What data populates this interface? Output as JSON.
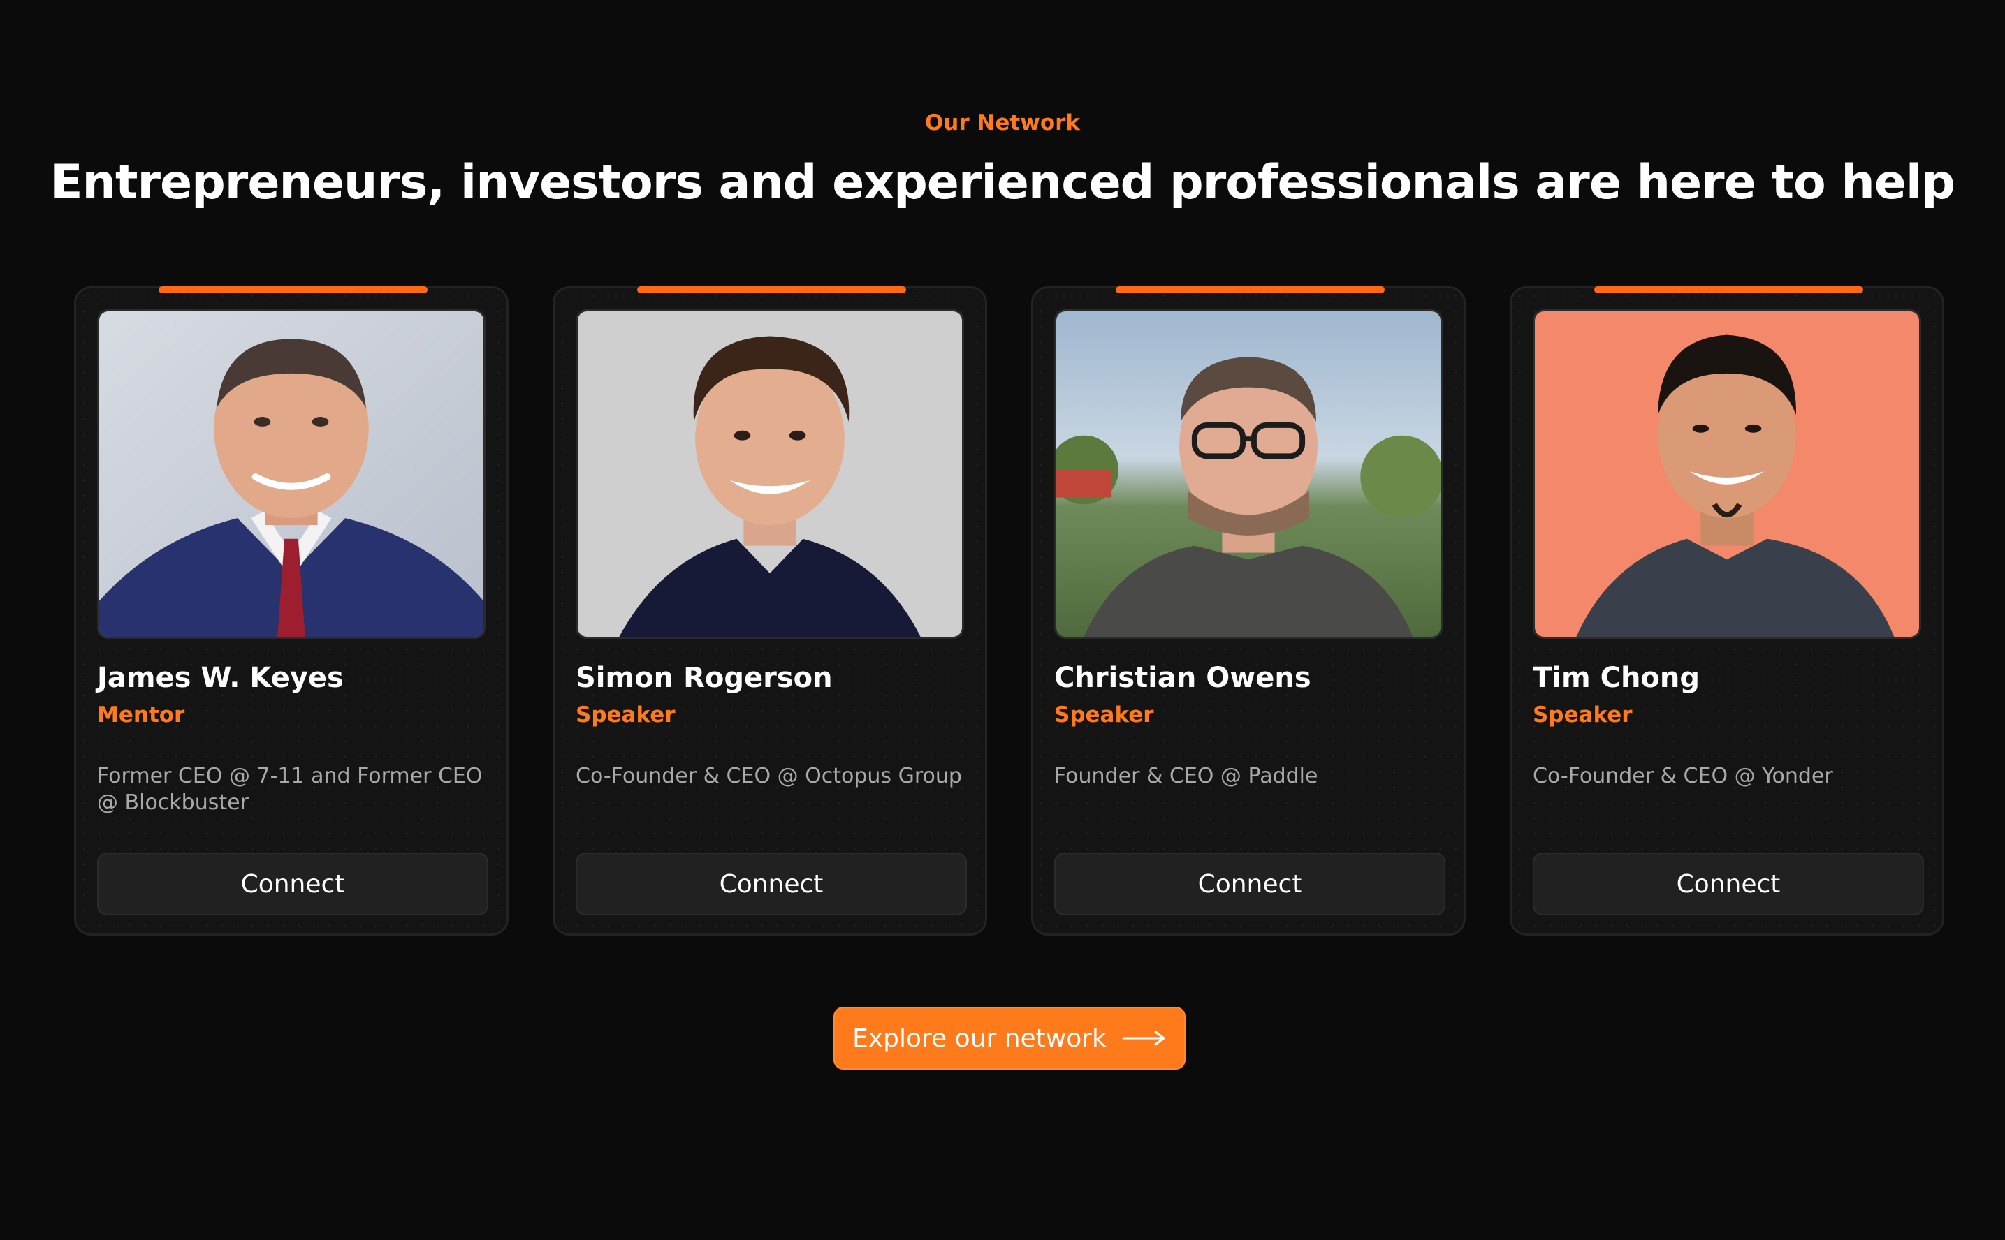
{
  "section": {
    "eyebrow": "Our Network",
    "headline": "Entrepreneurs, investors and experienced professionals are here to help"
  },
  "colors": {
    "accent": "#ff7a1a",
    "background": "#0b0b0b",
    "card": "#141414",
    "button": "#212121"
  },
  "people": [
    {
      "name": "James W. Keyes",
      "role": "Mentor",
      "bio": "Former CEO @ 7-11 and Former CEO @ Blockbuster",
      "cta": "Connect",
      "photo_icon": "portrait-man-suit"
    },
    {
      "name": "Simon Rogerson",
      "role": "Speaker",
      "bio": "Co-Founder & CEO @ Octopus Group",
      "cta": "Connect",
      "photo_icon": "portrait-man-smiling"
    },
    {
      "name": "Christian Owens",
      "role": "Speaker",
      "bio": "Founder & CEO @ Paddle",
      "cta": "Connect",
      "photo_icon": "portrait-man-glasses"
    },
    {
      "name": "Tim Chong",
      "role": "Speaker",
      "bio": "Co-Founder & CEO @ Yonder",
      "cta": "Connect",
      "photo_icon": "portrait-man-orange-bg"
    }
  ],
  "explore_button": {
    "label": "Explore our network",
    "icon": "arrow-right-icon"
  }
}
